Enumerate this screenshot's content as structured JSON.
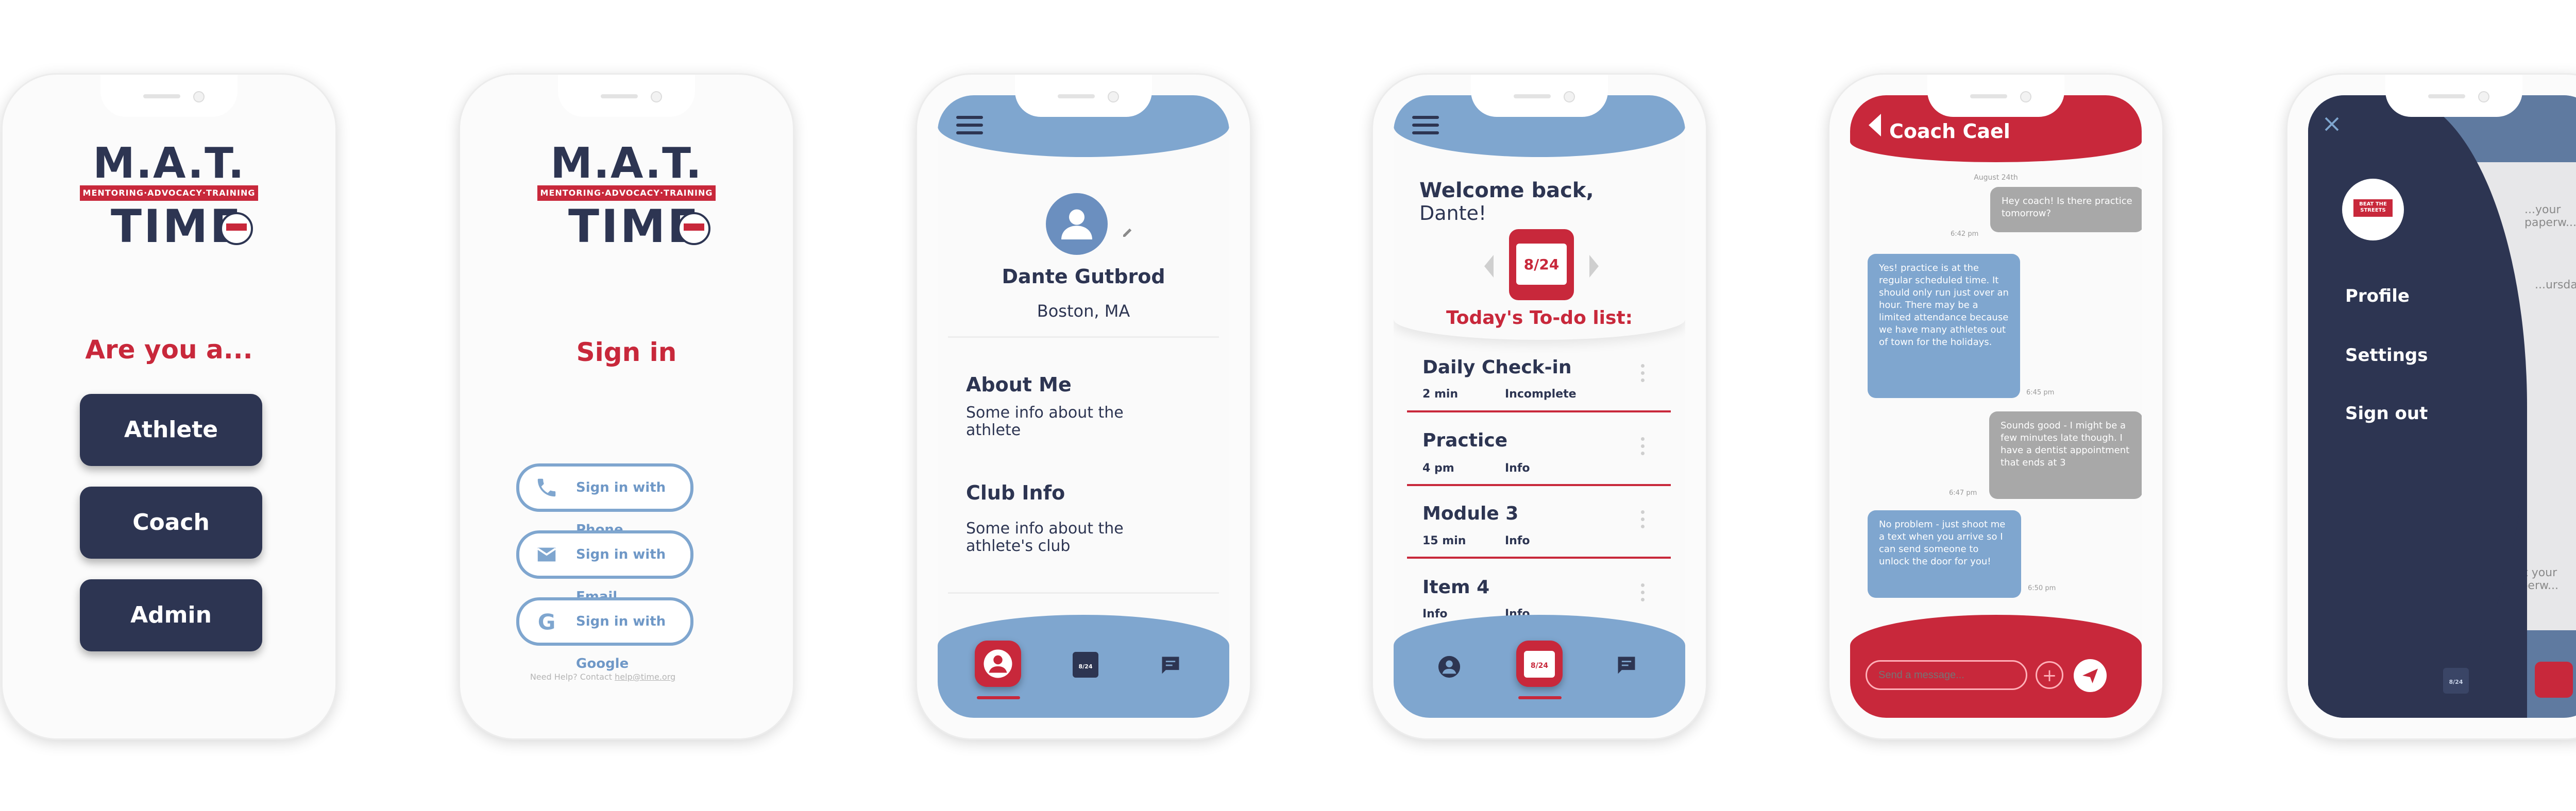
{
  "screen1": {
    "logo_top": "M.A.T.",
    "logo_band": "MENTORING·ADVOCACY·TRAINING",
    "logo_bottom": "TIME",
    "prompt": "Are you a...",
    "roles": [
      "Athlete",
      "Coach",
      "Admin"
    ]
  },
  "screen2": {
    "logo_top": "M.A.T.",
    "logo_band": "MENTORING·ADVOCACY·TRAINING",
    "logo_bottom": "TIME",
    "title": "Sign in",
    "options": [
      {
        "label": "Sign in with Phone",
        "icon": "phone-icon"
      },
      {
        "label": "Sign in with Email",
        "icon": "email-icon"
      },
      {
        "label": "Sign in with Google",
        "icon": "google-icon"
      }
    ],
    "help_prefix": "Need Help? Contact ",
    "help_email": "help@time.org"
  },
  "screen3": {
    "name": "Dante Gutbrod",
    "location": "Boston, MA",
    "about_title": "About Me",
    "about_body": "Some info about the athlete",
    "club_title": "Club Info",
    "club_body": "Some info about the athlete's club",
    "calendar_icon_text": "8/24"
  },
  "screen4": {
    "welcome": "Welcome back,",
    "name": "Dante!",
    "date": "8/24",
    "todo_heading": "Today's To-do list:",
    "todos": [
      {
        "title": "Daily Check-in",
        "left": "2 min",
        "right": "Incomplete"
      },
      {
        "title": "Practice",
        "left": "4 pm",
        "right": "Info"
      },
      {
        "title": "Module 3",
        "left": "15 min",
        "right": "Info"
      },
      {
        "title": "Item 4",
        "left": "Info",
        "right": "Info"
      }
    ],
    "calendar_icon_text": "8/24"
  },
  "screen5": {
    "header": "Coach Cael",
    "date_label": "August 24th",
    "messages": [
      {
        "from": "me",
        "text": "Hey coach! Is there practice tomorrow?",
        "time": "6:42 pm"
      },
      {
        "from": "coach",
        "text": "Yes! practice is at the regular scheduled time. It should only run just over an hour. There may be a limited attendance because we have many athletes out of town for the holidays.",
        "time": "6:45 pm"
      },
      {
        "from": "me",
        "text": "Sounds good - I might be a few minutes late though. I have a dentist appointment that ends at 3",
        "time": "6:47 pm"
      },
      {
        "from": "coach",
        "text": "No problem - just shoot me a text when you arrive so I can send someone to unlock the door for you!",
        "time": "6:50 pm"
      }
    ],
    "input_placeholder": "Send a message..."
  },
  "screen6": {
    "menu": [
      "Profile",
      "Settings",
      "Sign out"
    ],
    "behind_texts": [
      "...your paperw...",
      "...ursda...",
      "...ct your paperw..."
    ],
    "calendar_icon_text": "8/24",
    "logo_text": "BEAT THE STREETS"
  },
  "colors": {
    "navy": "#2d3552",
    "red": "#c8283b",
    "blue": "#7fa6cf",
    "gray_bubble": "#a8a8a8"
  }
}
